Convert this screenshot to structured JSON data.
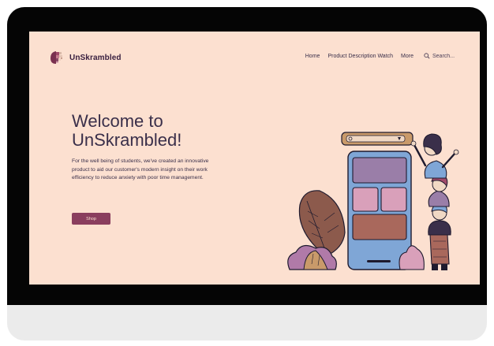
{
  "brand": {
    "name": "UnSkrambled"
  },
  "nav": {
    "links": [
      "Home",
      "Product Description Watch",
      "More"
    ],
    "search_placeholder": "Search..."
  },
  "hero": {
    "title": "Welcome to\nUnSkrambled!",
    "body": "For the well being of students, we've created an innovative product to aid our customer's modern insight on their work efficiency to reduce anxiety with poor time management.",
    "button_label": "Shop"
  },
  "colors": {
    "page_background": "#fce0d0",
    "accent": "#8a3e5e",
    "text": "#3a2f4a",
    "device": "#050505"
  },
  "icons": [
    "logo-mark",
    "search-icon"
  ]
}
